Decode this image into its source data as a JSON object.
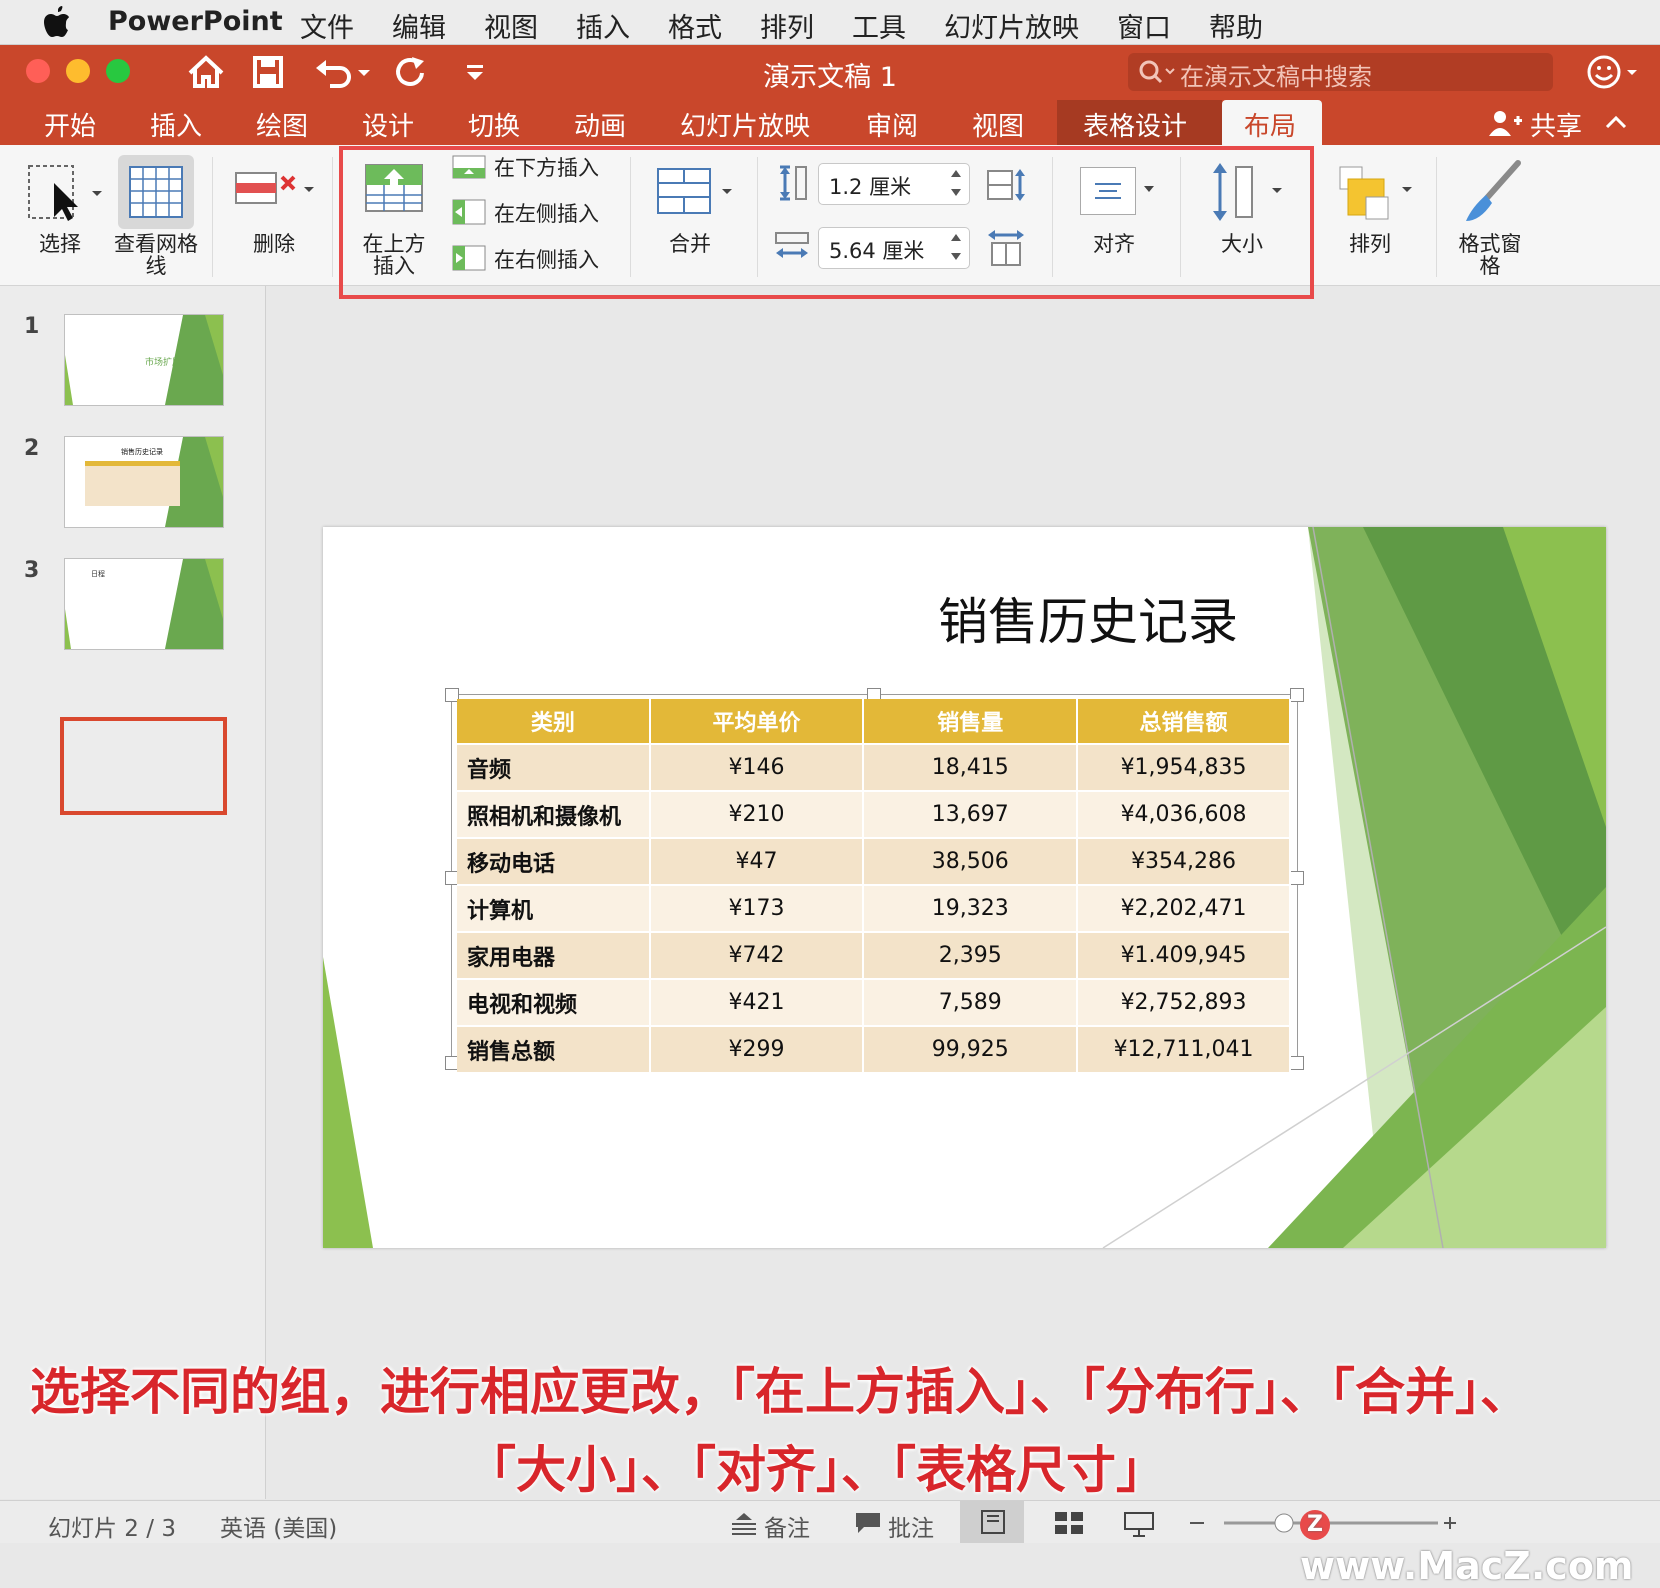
{
  "menubar": {
    "app_name": "PowerPoint",
    "items": [
      "文件",
      "编辑",
      "视图",
      "插入",
      "格式",
      "排列",
      "工具",
      "幻灯片放映",
      "窗口",
      "帮助"
    ]
  },
  "titlebar": {
    "doc_title": "演示文稿 1",
    "search_placeholder": "在演示文稿中搜索"
  },
  "tabs": {
    "items": [
      "开始",
      "插入",
      "绘图",
      "设计",
      "切换",
      "动画",
      "幻灯片放映",
      "审阅",
      "视图",
      "表格设计",
      "布局"
    ],
    "active": "布局",
    "share": "共享"
  },
  "ribbon": {
    "select": "选择",
    "view_gridlines": "查看网格线",
    "delete": "删除",
    "insert_above": "在上方插入",
    "insert_below": "在下方插入",
    "insert_left": "在左侧插入",
    "insert_right": "在右侧插入",
    "merge": "合并",
    "row_height": "1.2 厘米",
    "col_width": "5.64 厘米",
    "align": "对齐",
    "size": "大小",
    "arrange": "排列",
    "format_pane": "格式窗格"
  },
  "slides_pane": {
    "numbers": [
      "1",
      "2",
      "3"
    ],
    "thumb1_title": "市场扩展",
    "thumb2_title": "销售历史记录",
    "thumb3_title": "日程"
  },
  "slide": {
    "title": "销售历史记录",
    "table": {
      "headers": [
        "类别",
        "平均单价",
        "销售量",
        "总销售额"
      ],
      "rows": [
        [
          "音频",
          "¥146",
          "18,415",
          "¥1,954,835"
        ],
        [
          "照相机和摄像机",
          "¥210",
          "13,697",
          "¥4,036,608"
        ],
        [
          "移动电话",
          "¥47",
          "38,506",
          "¥354,286"
        ],
        [
          "计算机",
          "¥173",
          "19,323",
          "¥2,202,471"
        ],
        [
          "家用电器",
          "¥742",
          "2,395",
          "¥1.409,945"
        ],
        [
          "电视和视频",
          "¥421",
          "7,589",
          "¥2,752,893"
        ],
        [
          "销售总额",
          "¥299",
          "99,925",
          "¥12,711,041"
        ]
      ]
    }
  },
  "caption": {
    "line1": "选择不同的组，进行相应更改，「在上方插入」、「分布行」、「合并」、",
    "line2": "「大小」、「对齐」、「表格尺寸」"
  },
  "statusbar": {
    "slide_info": "幻灯片 2 / 3",
    "language": "英语 (美国)",
    "notes": "备注",
    "comments": "批注",
    "watermark": "www.MacZ.com"
  },
  "colors": {
    "accent": "#c9472b",
    "highlight": "#e84a4a",
    "table_header": "#e3b838",
    "green": "#6aa84f"
  }
}
